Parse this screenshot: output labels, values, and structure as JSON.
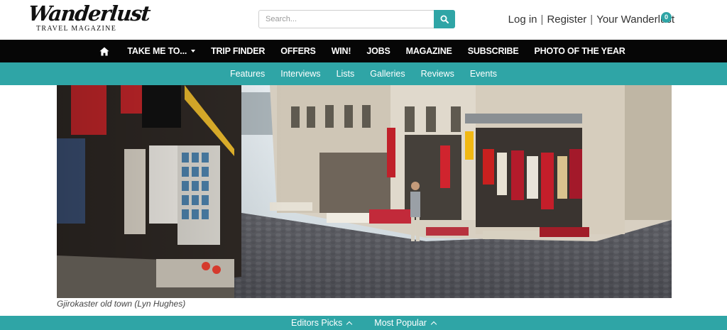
{
  "logo": {
    "name": "Wanderlust",
    "tagline": "TRAVEL MAGAZINE"
  },
  "search": {
    "placeholder": "Search..."
  },
  "account": {
    "login": "Log in",
    "register": "Register",
    "your_wanderlust": "Your Wanderlust",
    "badge_count": "0"
  },
  "main_nav": {
    "items": [
      "TAKE ME TO...",
      "TRIP FINDER",
      "OFFERS",
      "WIN!",
      "JOBS",
      "MAGAZINE",
      "SUBSCRIBE",
      "PHOTO OF THE YEAR"
    ]
  },
  "sub_nav": {
    "items": [
      "Features",
      "Interviews",
      "Lists",
      "Galleries",
      "Reviews",
      "Events"
    ]
  },
  "hero": {
    "caption": "Gjirokaster old town (Lyn Hughes)"
  },
  "bottom_bar": {
    "editors_picks": "Editors Picks",
    "most_popular": "Most Popular"
  },
  "colors": {
    "teal": "#2fa5a6",
    "nav_black": "#060606"
  },
  "icons": {
    "search": "search-icon",
    "home": "home-icon"
  }
}
